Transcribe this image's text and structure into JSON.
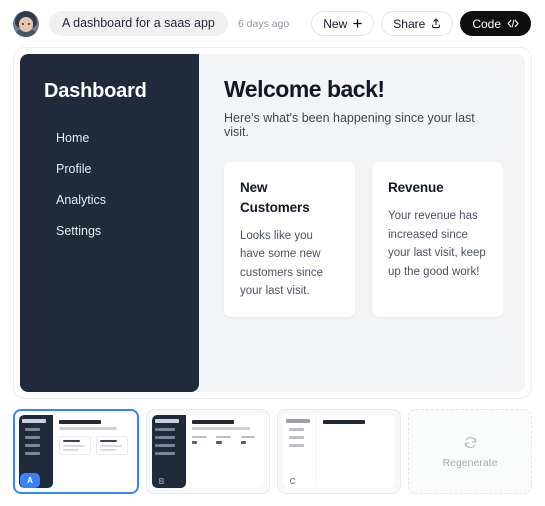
{
  "topbar": {
    "avatar_name": "user-avatar",
    "project_title": "A dashboard for a saas app",
    "timestamp": "6 days ago",
    "buttons": [
      {
        "label": "New",
        "icon": "plus-icon",
        "style": "light"
      },
      {
        "label": "Share",
        "icon": "share-upload-icon",
        "style": "light"
      },
      {
        "label": "Code",
        "icon": "code-brackets-icon",
        "style": "dark"
      }
    ]
  },
  "app": {
    "sidebar": {
      "title": "Dashboard",
      "items": [
        {
          "label": "Home"
        },
        {
          "label": "Profile"
        },
        {
          "label": "Analytics"
        },
        {
          "label": "Settings"
        }
      ],
      "bg_color": "#212a3a"
    },
    "main": {
      "heading": "Welcome back!",
      "subtitle": "Here's what's been happening since your last visit.",
      "cards": [
        {
          "title": "New Customers",
          "body": "Looks like you have some new customers since your last visit."
        },
        {
          "title": "Revenue",
          "body": "Your revenue has increased since your last visit, keep up the good work!"
        }
      ]
    },
    "bg_color": "#f3f4f6"
  },
  "variants": {
    "accent_color": "#3b82f6",
    "items": [
      {
        "badge": "A",
        "selected": true,
        "layout": "dark-sidebar-cards"
      },
      {
        "badge": "B",
        "selected": false,
        "layout": "dark-sidebar-stats"
      },
      {
        "badge": "C",
        "selected": false,
        "layout": "light-sidebar-plain"
      }
    ],
    "regenerate": {
      "label": "Regenerate",
      "icon": "refresh-icon"
    }
  }
}
